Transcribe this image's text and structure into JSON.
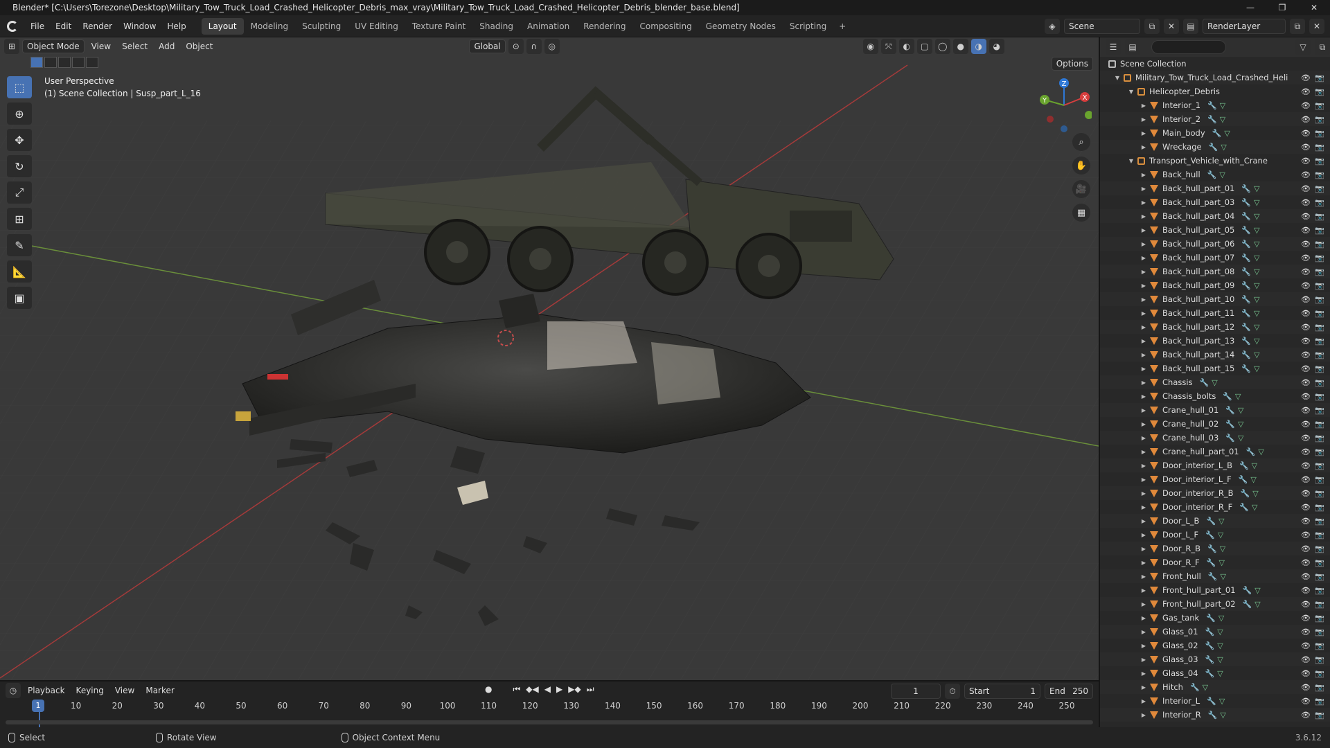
{
  "window": {
    "title": "Blender* [C:\\Users\\Torezone\\Desktop\\Military_Tow_Truck_Load_Crashed_Helicopter_Debris_max_vray\\Military_Tow_Truck_Load_Crashed_Helicopter_Debris_blender_base.blend]",
    "controls": [
      "—",
      "❐",
      "✕"
    ]
  },
  "menu": [
    "File",
    "Edit",
    "Render",
    "Window",
    "Help"
  ],
  "workspaces": [
    "Layout",
    "Modeling",
    "Sculpting",
    "UV Editing",
    "Texture Paint",
    "Shading",
    "Animation",
    "Rendering",
    "Compositing",
    "Geometry Nodes",
    "Scripting"
  ],
  "active_workspace": "Layout",
  "scene_name": "Scene",
  "render_layer": "RenderLayer",
  "viewport": {
    "mode": "Object Mode",
    "menus": [
      "View",
      "Select",
      "Add",
      "Object"
    ],
    "transform_orientation": "Global",
    "options_label": "Options",
    "perspective_label": "User Perspective",
    "active_object_label": "(1) Scene Collection | Susp_part_L_16",
    "gizmo_axes": {
      "x": "X",
      "y": "Y",
      "z": "Z"
    }
  },
  "outliner": {
    "root": "Scene Collection",
    "main_collection": "Military_Tow_Truck_Load_Crashed_Heli",
    "helicopter_collection": "Helicopter_Debris",
    "helicopter_items": [
      "Interior_1",
      "Interior_2",
      "Main_body",
      "Wreckage"
    ],
    "truck_collection": "Transport_Vehicle_with_Crane",
    "truck_items": [
      "Back_hull",
      "Back_hull_part_01",
      "Back_hull_part_03",
      "Back_hull_part_04",
      "Back_hull_part_05",
      "Back_hull_part_06",
      "Back_hull_part_07",
      "Back_hull_part_08",
      "Back_hull_part_09",
      "Back_hull_part_10",
      "Back_hull_part_11",
      "Back_hull_part_12",
      "Back_hull_part_13",
      "Back_hull_part_14",
      "Back_hull_part_15",
      "Chassis",
      "Chassis_bolts",
      "Crane_hull_01",
      "Crane_hull_02",
      "Crane_hull_03",
      "Crane_hull_part_01",
      "Door_interior_L_B",
      "Door_interior_L_F",
      "Door_interior_R_B",
      "Door_interior_R_F",
      "Door_L_B",
      "Door_L_F",
      "Door_R_B",
      "Door_R_F",
      "Front_hull",
      "Front_hull_part_01",
      "Front_hull_part_02",
      "Gas_tank",
      "Glass_01",
      "Glass_02",
      "Glass_03",
      "Glass_04",
      "Hitch",
      "Interior_L",
      "Interior_R"
    ]
  },
  "timeline": {
    "menus": [
      "Playback",
      "Keying",
      "View",
      "Marker"
    ],
    "current_frame": "1",
    "start_label": "Start",
    "start": "1",
    "end_label": "End",
    "end": "250",
    "ruler": [
      "10",
      "20",
      "30",
      "40",
      "50",
      "60",
      "70",
      "80",
      "90",
      "100",
      "110",
      "120",
      "130",
      "140",
      "150",
      "160",
      "170",
      "180",
      "190",
      "200",
      "210",
      "220",
      "230",
      "240",
      "250"
    ]
  },
  "status": {
    "select": "Select",
    "rotate": "Rotate View",
    "context": "Object Context Menu",
    "version": "3.6.12"
  },
  "colors": {
    "accent": "#4772b3",
    "object_icon": "#e0893b",
    "modifier_icon": "#6c9ee8",
    "mesh_icon": "#76c28e"
  }
}
